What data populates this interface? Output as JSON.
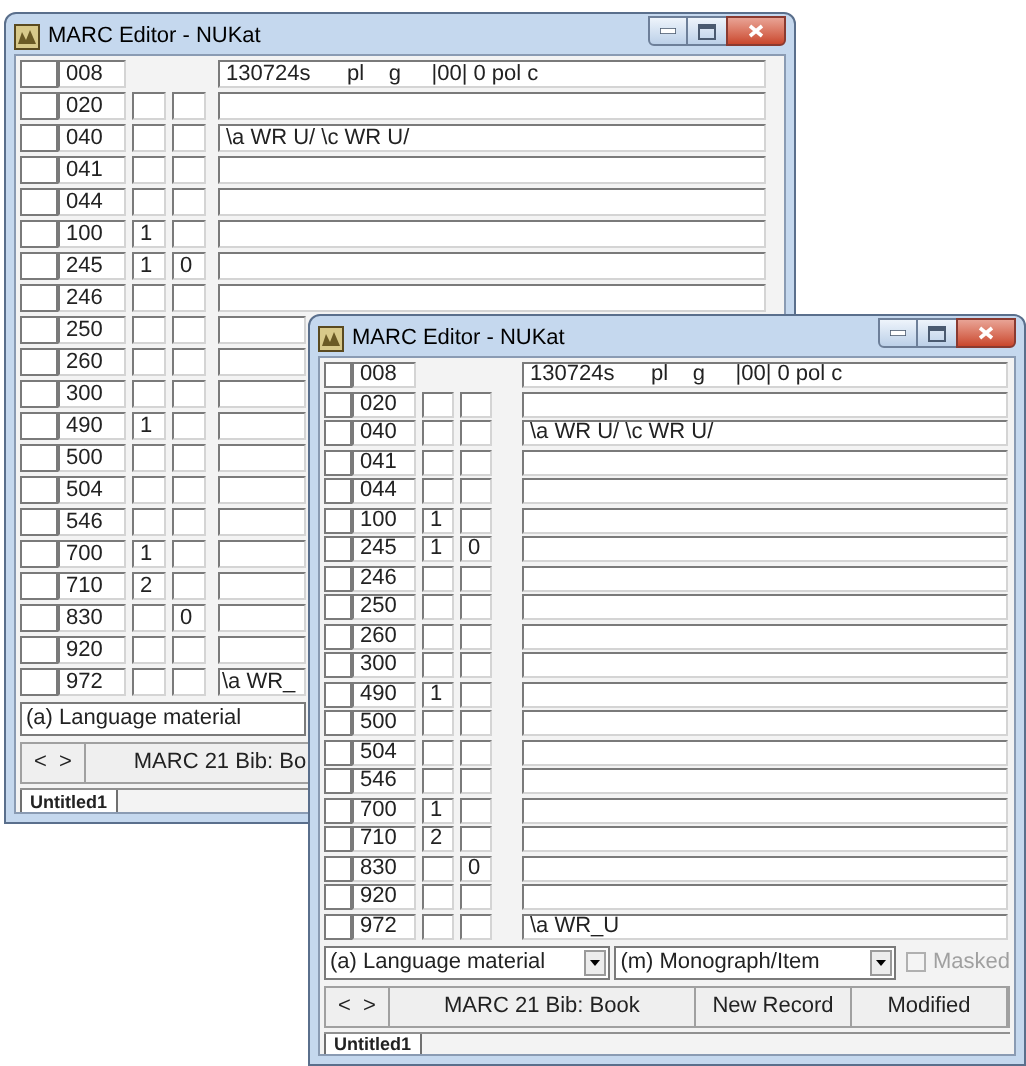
{
  "windows": [
    {
      "title": "MARC Editor - NUKat",
      "fields": [
        {
          "kind": "control",
          "tag": "008",
          "data": "130724s      pl    g     |00| 0 pol c"
        },
        {
          "kind": "data",
          "tag": "020"
        },
        {
          "kind": "data",
          "tag": "040",
          "data": "\\a WR U/ \\c WR U/"
        },
        {
          "kind": "data",
          "tag": "041"
        },
        {
          "kind": "data",
          "tag": "044"
        },
        {
          "kind": "data",
          "tag": "100",
          "ind1": "1"
        },
        {
          "kind": "data",
          "tag": "245",
          "ind1": "1",
          "ind2": "0"
        },
        {
          "kind": "data",
          "tag": "246"
        },
        {
          "kind": "data",
          "tag": "250"
        },
        {
          "kind": "data",
          "tag": "260"
        },
        {
          "kind": "data",
          "tag": "300"
        },
        {
          "kind": "data",
          "tag": "490",
          "ind1": "1"
        },
        {
          "kind": "data",
          "tag": "500"
        },
        {
          "kind": "data",
          "tag": "504"
        },
        {
          "kind": "data",
          "tag": "546"
        },
        {
          "kind": "data",
          "tag": "700",
          "ind1": "1"
        },
        {
          "kind": "data",
          "tag": "710",
          "ind1": "2"
        },
        {
          "kind": "data",
          "tag": "830",
          "ind2": "0"
        },
        {
          "kind": "data",
          "tag": "920"
        },
        {
          "kind": "data",
          "tag": "972",
          "data": "\\a WR_"
        }
      ],
      "selectors": [
        "(a) Language material"
      ],
      "nav": [
        "<",
        ">"
      ],
      "status": [
        "MARC 21 Bib: Bo"
      ],
      "tabs": [
        {
          "label": "Untitled1",
          "selected": true
        }
      ]
    },
    {
      "title": "MARC Editor - NUKat",
      "fields": [
        {
          "kind": "control",
          "tag": "008",
          "data": "130724s      pl    g     |00| 0 pol c"
        },
        {
          "kind": "data",
          "tag": "020"
        },
        {
          "kind": "data",
          "tag": "040",
          "data": "\\a WR U/ \\c WR U/"
        },
        {
          "kind": "data",
          "tag": "041"
        },
        {
          "kind": "data",
          "tag": "044"
        },
        {
          "kind": "data",
          "tag": "100",
          "ind1": "1"
        },
        {
          "kind": "data",
          "tag": "245",
          "ind1": "1",
          "ind2": "0"
        },
        {
          "kind": "data",
          "tag": "246"
        },
        {
          "kind": "data",
          "tag": "250"
        },
        {
          "kind": "data",
          "tag": "260"
        },
        {
          "kind": "data",
          "tag": "300"
        },
        {
          "kind": "data",
          "tag": "490",
          "ind1": "1"
        },
        {
          "kind": "data",
          "tag": "500"
        },
        {
          "kind": "data",
          "tag": "504"
        },
        {
          "kind": "data",
          "tag": "546"
        },
        {
          "kind": "data",
          "tag": "700",
          "ind1": "1"
        },
        {
          "kind": "data",
          "tag": "710",
          "ind1": "2"
        },
        {
          "kind": "data",
          "tag": "830",
          "ind2": "0"
        },
        {
          "kind": "data",
          "tag": "920"
        },
        {
          "kind": "data",
          "tag": "972",
          "data": "\\a WR_U"
        }
      ],
      "selectors": [
        "(a) Language material",
        "(m) Monograph/Item"
      ],
      "masked": {
        "label": "Masked",
        "checked": false,
        "disabled": true
      },
      "nav": [
        "<",
        ">"
      ],
      "status": [
        "MARC 21 Bib: Book",
        "New Record",
        "Modified"
      ],
      "tabs": [
        {
          "label": "Untitled1",
          "selected": true
        }
      ]
    }
  ]
}
